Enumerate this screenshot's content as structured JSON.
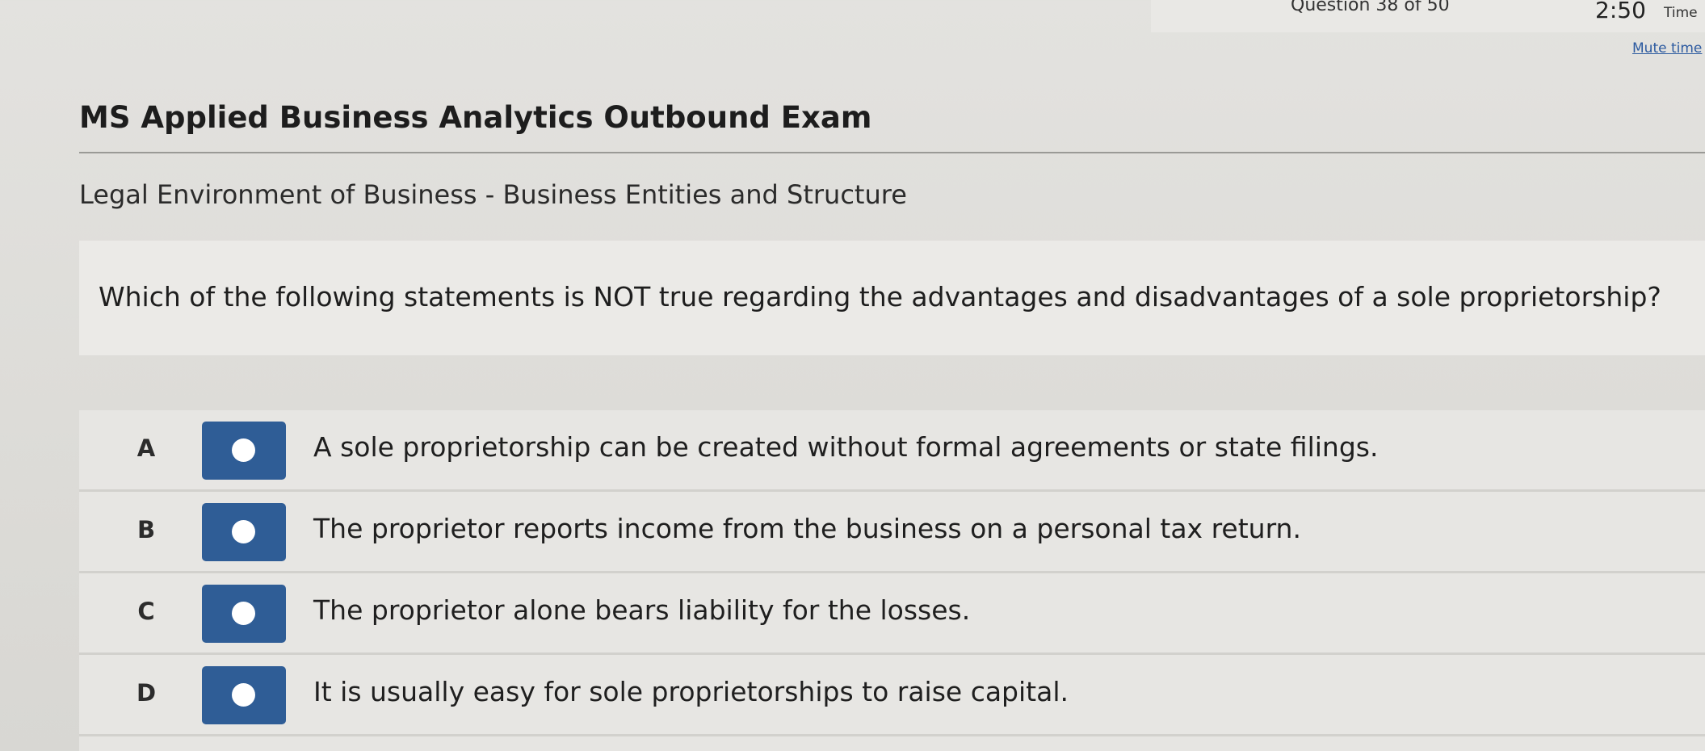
{
  "header": {
    "question_counter": "Question 38 of 50",
    "timer_value": "2:50",
    "timer_label": "Time",
    "mute_link": "Mute time"
  },
  "exam": {
    "title": "MS Applied Business Analytics Outbound Exam",
    "subtitle": "Legal Environment of Business - Business Entities and Structure"
  },
  "question": {
    "text": "Which of the following statements is NOT true regarding the advantages and disadvantages of a sole proprietorship?"
  },
  "answers": [
    {
      "letter": "A",
      "text": "A sole proprietorship can be created without formal agreements or state filings."
    },
    {
      "letter": "B",
      "text": "The proprietor reports income from the business on a personal tax return."
    },
    {
      "letter": "C",
      "text": "The proprietor alone bears liability for the losses."
    },
    {
      "letter": "D",
      "text": "It is usually easy for sole proprietorships to raise capital."
    }
  ],
  "colors": {
    "radio_button": "#2f5d96",
    "link": "#2c5aa0"
  }
}
